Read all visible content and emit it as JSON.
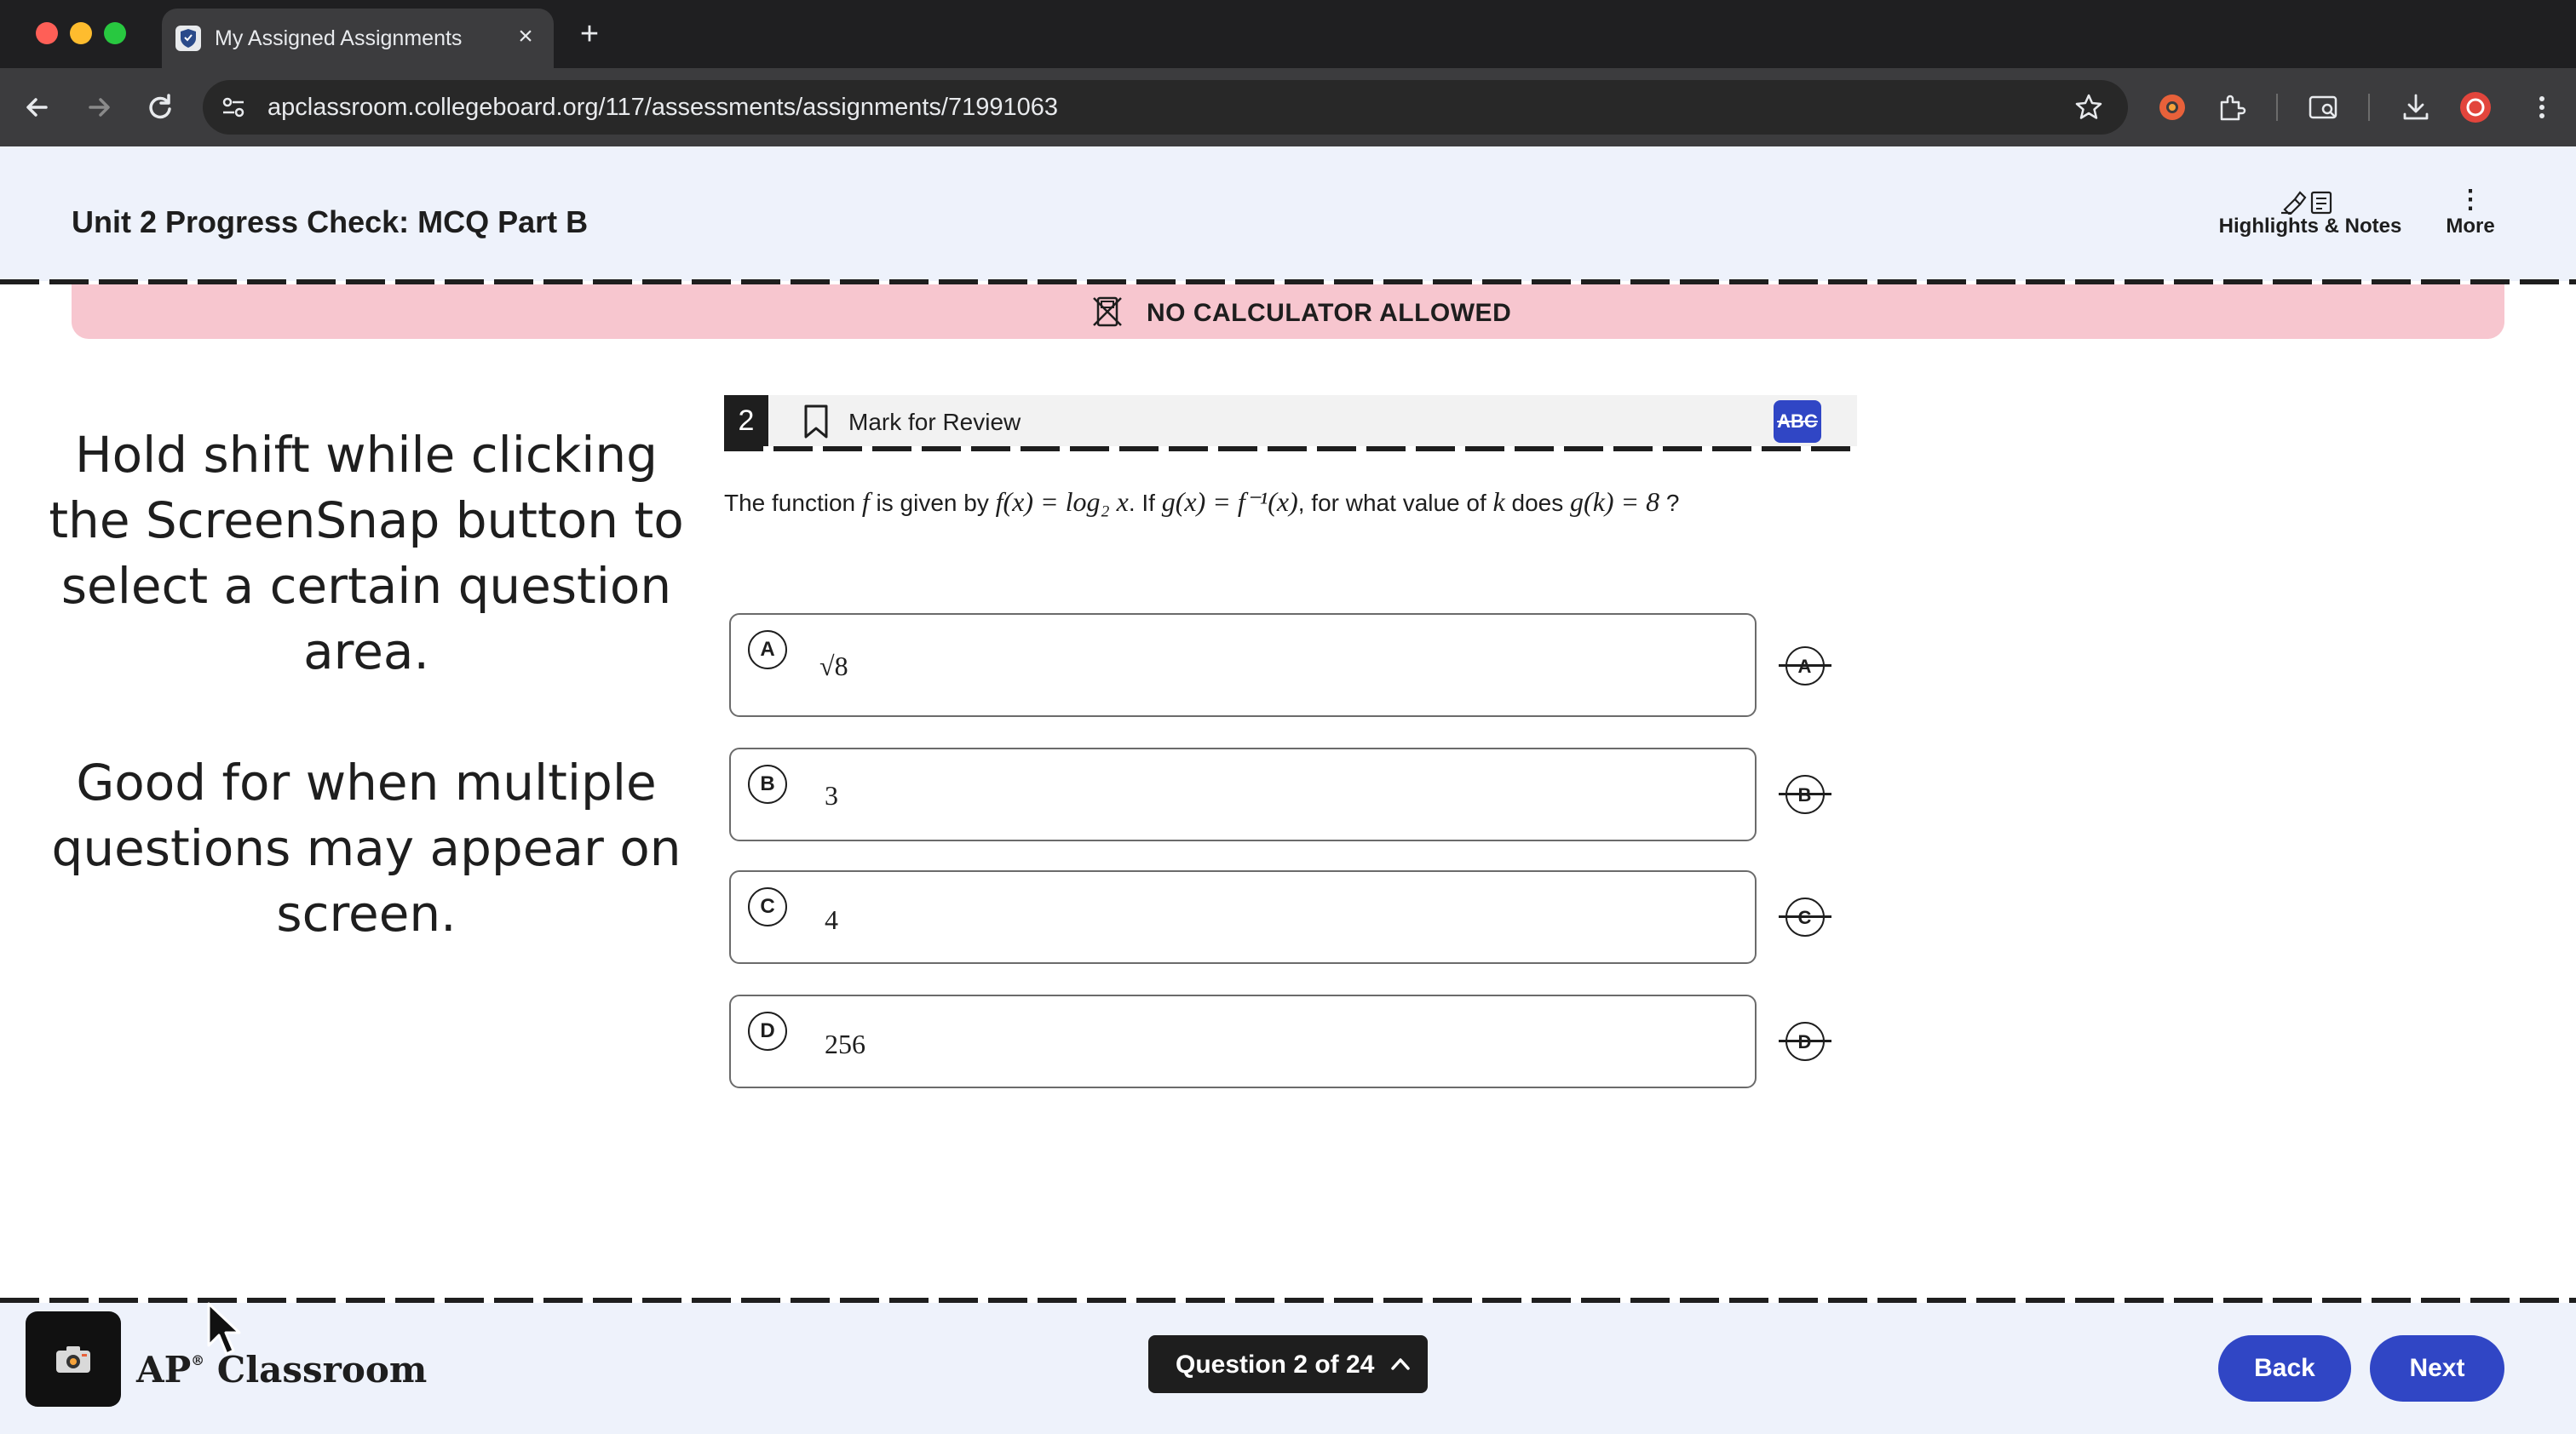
{
  "browser": {
    "tab_title": "My Assigned Assignments",
    "tab_close_label": "×",
    "new_tab_label": "+",
    "url": "apclassroom.collegeboard.org/117/assessments/assignments/71991063"
  },
  "header": {
    "title": "Unit 2 Progress Check: MCQ Part B",
    "highlights_label": "Highlights & Notes",
    "more_label": "More",
    "more_icon": "⋮"
  },
  "banner": {
    "text": "NO CALCULATOR ALLOWED",
    "color": "#f7c6cf"
  },
  "overlay": {
    "paragraph1": "Hold shift while clicking the ScreenSnap button to select a certain question area.",
    "paragraph2": "Good for when multiple questions may appear on screen."
  },
  "question": {
    "number": "2",
    "mark_for_review": "Mark for Review",
    "abc_label": "ABC",
    "stem": {
      "t1": "The function ",
      "m1": "f",
      "t2": " is given by ",
      "m2": "f(x) = log₂ x",
      "t3": ". If ",
      "m3": "g(x) = f⁻¹(x)",
      "t4": ", for what value of ",
      "m4": "k",
      "t5": " does ",
      "m5": "g(k) = 8",
      "t6": " ?"
    },
    "choices": [
      {
        "letter": "A",
        "value": "√8"
      },
      {
        "letter": "B",
        "value": "3"
      },
      {
        "letter": "C",
        "value": "4"
      },
      {
        "letter": "D",
        "value": "256"
      }
    ]
  },
  "footer": {
    "brand": "AP",
    "brand_mark": "®",
    "brand_suffix": "Classroom",
    "question_nav": "Question 2 of 24",
    "back_label": "Back",
    "next_label": "Next",
    "accent": "#3046c5"
  }
}
